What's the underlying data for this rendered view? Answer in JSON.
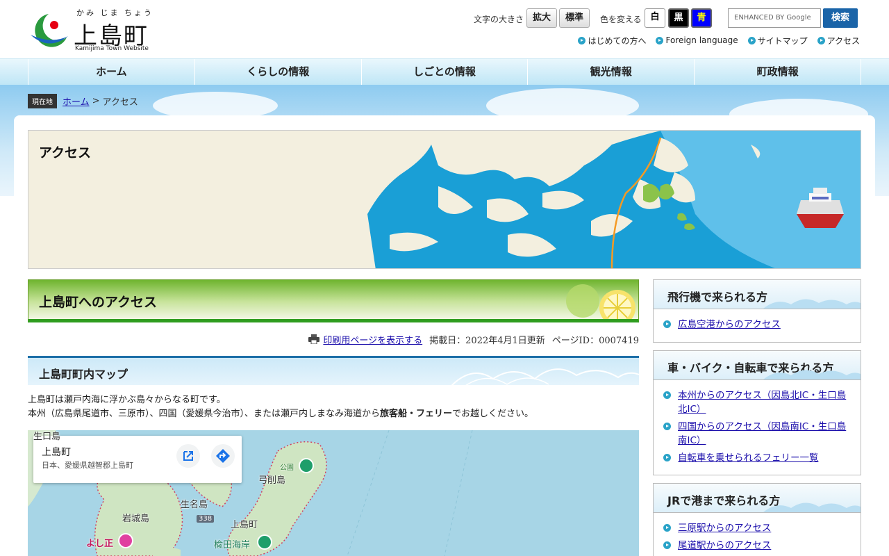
{
  "header": {
    "logo_kana": "かみ じま ちょう",
    "logo_name": "上島町",
    "logo_en": "Kamijima Town Website",
    "font_size_label": "文字の大きさ",
    "font_size_buttons": [
      "拡大",
      "標準"
    ],
    "color_label": "色を変える",
    "color_buttons": [
      {
        "label": "白",
        "bg": "#ffffff",
        "fg": "#000000"
      },
      {
        "label": "黒",
        "bg": "#000000",
        "fg": "#ffffff"
      },
      {
        "label": "青",
        "bg": "#0000ff",
        "fg": "#ffff00"
      }
    ],
    "search_placeholder": "ENHANCED BY Google",
    "search_button": "検索",
    "sublinks": [
      "はじめての方へ",
      "Foreign language",
      "サイトマップ",
      "アクセス"
    ]
  },
  "nav": [
    "ホーム",
    "くらしの情報",
    "しごとの情報",
    "観光情報",
    "町政情報"
  ],
  "breadcrumb": {
    "label": "現在地",
    "home": "ホーム",
    "separator": ">",
    "current": "アクセス"
  },
  "hero": {
    "title": "アクセス"
  },
  "page": {
    "title": "上島町へのアクセス",
    "print_link": "印刷用ページを表示する",
    "published": "掲載日：2022年4月1日更新",
    "page_id": "ページID：0007419",
    "section_title": "上島町町内マップ",
    "intro_line1": "上島町は瀬戸内海に浮かぶ島々からなる町です。",
    "intro_line2_pre": "本州（広島県尾道市、三原市）、四国（愛媛県今治市）、または瀬戸内しまなみ海道から",
    "intro_line2_bold": "旅客船・フェリー",
    "intro_line2_post": "でお越しください。"
  },
  "map": {
    "card_title": "上島町",
    "card_address": "日本、愛媛県越智郡上島町",
    "labels": {
      "ikuchi": "生口島",
      "yuge": "弓削島",
      "ikina": "生名島",
      "iwagi": "岩城島",
      "kamijima": "上島町",
      "park": "公園",
      "beach": "楡田海岸",
      "hotel": "よし正",
      "route": "338"
    }
  },
  "sidebar": [
    {
      "title": "飛行機で来られる方",
      "links": [
        "広島空港からのアクセス"
      ]
    },
    {
      "title": "車・バイク・自転車で来られる方",
      "links": [
        "本州からのアクセス（因島北IC・生口島北IC）",
        "四国からのアクセス（因島南IC・生口島南IC）",
        "自転車を乗せられるフェリー一覧"
      ]
    },
    {
      "title": "JRで港まで来られる方",
      "links": [
        "三原駅からのアクセス",
        "尾道駅からのアクセス"
      ]
    }
  ],
  "colors": {
    "accent_blue": "#1c6fa8",
    "accent_green": "#2f9d1f",
    "sea": "#1a9fd6",
    "link": "#1a0dab"
  }
}
